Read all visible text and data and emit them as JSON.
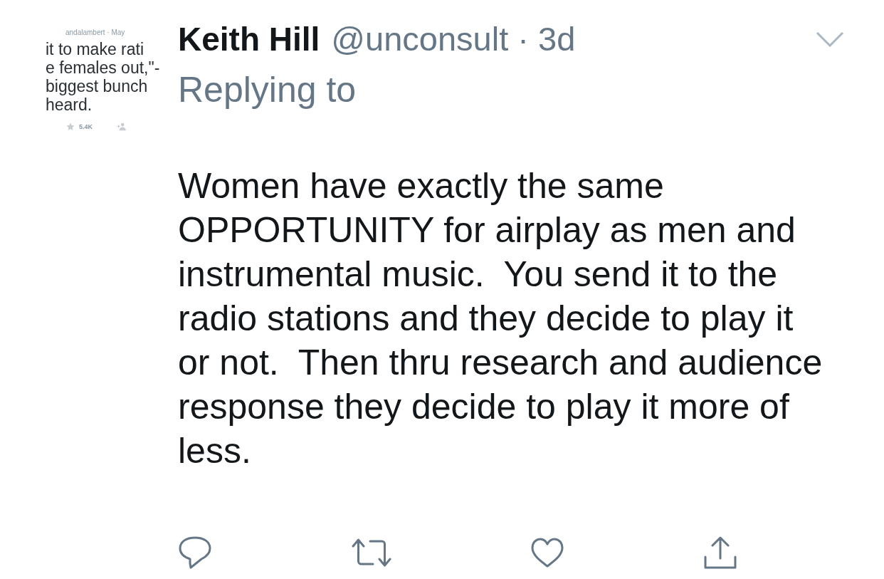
{
  "quoted_screenshot": {
    "meta": "andalambert · May",
    "lines": [
      "it to make rati",
      "e females out,\"-",
      "biggest bunch",
      "heard."
    ],
    "stats": [
      {
        "kind": "star",
        "count": "5.4K"
      },
      {
        "kind": "follow"
      }
    ]
  },
  "tweet": {
    "name": "Keith Hill",
    "meta": "@unconsult · 3d",
    "replying_to": "Replying to",
    "body": "Women have exactly the same OPPORTUNITY for airplay as men and instrumental music.  You send it to the radio stations and they decide to play it or not.  Then thru research and audience response they decide to play it more of less.",
    "actions": [
      {
        "kind": "reply"
      },
      {
        "kind": "retweet"
      },
      {
        "kind": "like"
      },
      {
        "kind": "share"
      }
    ]
  }
}
